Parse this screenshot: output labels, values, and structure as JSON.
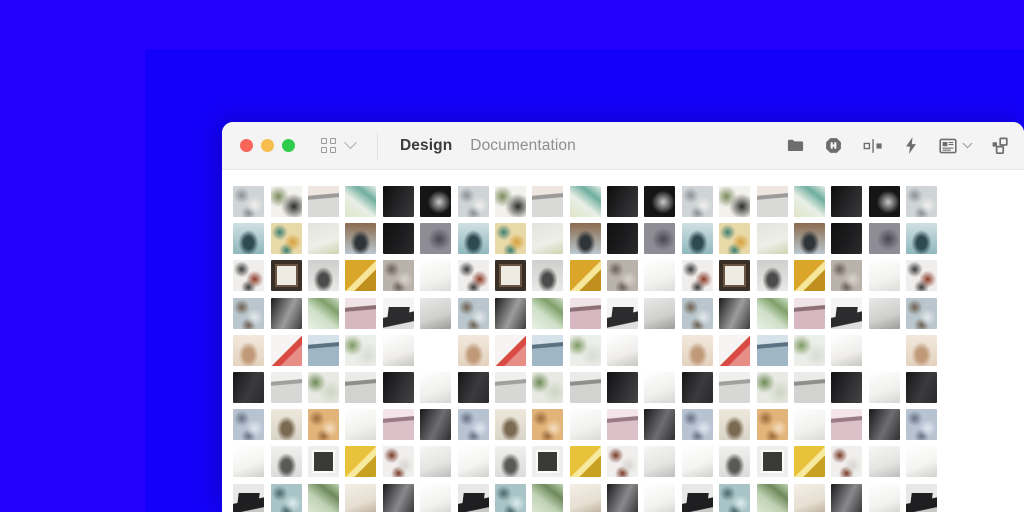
{
  "canvas": {
    "background_outer": "#2400ff",
    "background_inner": "#1400fa"
  },
  "window": {
    "traffic_lights": [
      {
        "name": "close",
        "color": "#f9655b"
      },
      {
        "name": "minimize",
        "color": "#f7bd4d"
      },
      {
        "name": "zoom",
        "color": "#2fcc4b"
      }
    ],
    "view_switcher": {
      "icon": "grid-icon",
      "chevron": "chevron-down-icon"
    },
    "tabs": [
      {
        "label": "Design",
        "active": true
      },
      {
        "label": "Documentation",
        "active": false
      }
    ],
    "toolbar_icons": [
      {
        "name": "folder-icon"
      },
      {
        "name": "components-octagon-icon"
      },
      {
        "name": "distribute-spacing-icon"
      },
      {
        "name": "lightning-bolt-icon"
      },
      {
        "name": "layout-preview-icon",
        "has_chevron": true
      },
      {
        "name": "duplicate-squares-icon"
      }
    ]
  },
  "gallery": {
    "columns": 19,
    "rows": 9,
    "tile_size": 31,
    "tile_pitch": 37.4,
    "palette_cycle": 6,
    "tiles": [
      {
        "id": "desk-flatlay",
        "c1": "#cfd4d6",
        "c2": "#8b9298",
        "c3": "#f0eeeb",
        "kind": "speckle"
      },
      {
        "id": "plant-person",
        "c1": "#f2f1ec",
        "c2": "#7b8a5c",
        "c3": "#2d2d2d",
        "kind": "leftleaf"
      },
      {
        "id": "grey-ceiling",
        "c1": "#d9d9d7",
        "c2": "#9b9b99",
        "c3": "#efe6e2",
        "kind": "bands"
      },
      {
        "id": "green-bottle",
        "c1": "#e9efe6",
        "c2": "#6fae9e",
        "c3": "#dfe4c8",
        "kind": "diag"
      },
      {
        "id": "dark-doorway",
        "c1": "#0c0c0d",
        "c2": "#272729",
        "c3": "#3a3a3c",
        "kind": "dark"
      },
      {
        "id": "dark-blur",
        "c1": "#151516",
        "c2": "#c9c9c9",
        "c3": "#2a2a2c",
        "kind": "darkblur"
      },
      {
        "id": "teal-portrait",
        "c1": "#8fb8bd",
        "c2": "#2f4a52",
        "c3": "#cfe0e2",
        "kind": "figure"
      },
      {
        "id": "colorful-desk",
        "c1": "#e8d9a8",
        "c2": "#3f7f6f",
        "c3": "#d6a03c",
        "kind": "speckle"
      },
      {
        "id": "paper-plant",
        "c1": "#efefea",
        "c2": "#cdd3b0",
        "c3": "#e3e3dd",
        "kind": "light"
      },
      {
        "id": "sunglasses-man",
        "c1": "#b9c7cf",
        "c2": "#2e3438",
        "c3": "#8b6b4e",
        "kind": "figure"
      },
      {
        "id": "black-square",
        "c1": "#0f0f10",
        "c2": "#1d1d1f",
        "c3": "#2b2b2d",
        "kind": "dark"
      },
      {
        "id": "street-blur",
        "c1": "#8e8d96",
        "c2": "#4a4650",
        "c3": "#c6c3cb",
        "kind": "darkblur"
      },
      {
        "id": "coffee-tools",
        "c1": "#efeeec",
        "c2": "#3b3b3b",
        "c3": "#8c3b2a",
        "kind": "speckle"
      },
      {
        "id": "framed-art",
        "c1": "#3a2f27",
        "c2": "#efeae2",
        "c3": "#6a5442",
        "kind": "frame"
      },
      {
        "id": "window-person",
        "c1": "#e9e9e7",
        "c2": "#4b4b4b",
        "c3": "#cfcfcd",
        "kind": "figure"
      },
      {
        "id": "yellow-notes",
        "c1": "#d9a62a",
        "c2": "#f6e79a",
        "c3": "#c08f1e",
        "kind": "notes"
      },
      {
        "id": "crowd-street",
        "c1": "#b9b2aa",
        "c2": "#6a625c",
        "c3": "#d8d2cb",
        "kind": "speckle"
      },
      {
        "id": "white-shelf",
        "c1": "#f2f2f0",
        "c2": "#dcdcd8",
        "c3": "#ffffff",
        "kind": "light"
      },
      {
        "id": "city-bench",
        "c1": "#b9c6cd",
        "c2": "#6f6152",
        "c3": "#e3e7ea",
        "kind": "speckle"
      },
      {
        "id": "dark-chair",
        "c1": "#1b1b1d",
        "c2": "#9c9c9c",
        "c3": "#3c3c3e",
        "kind": "dark"
      },
      {
        "id": "green-field",
        "c1": "#cfe0c8",
        "c2": "#7fa06a",
        "c3": "#eaf0e4",
        "kind": "diag"
      },
      {
        "id": "pink-building",
        "c1": "#d7b8c0",
        "c2": "#8e6f78",
        "c3": "#f0e2e5",
        "kind": "bands"
      },
      {
        "id": "white-laptop",
        "c1": "#f4f4f2",
        "c2": "#2c2c2e",
        "c3": "#dedede",
        "kind": "laptop"
      },
      {
        "id": "grey-wall",
        "c1": "#cfcfcd",
        "c2": "#9a9a98",
        "c3": "#e8e8e6",
        "kind": "light"
      },
      {
        "id": "nude-figure",
        "c1": "#e4d3c0",
        "c2": "#c09a78",
        "c3": "#f2e8dc",
        "kind": "figure"
      },
      {
        "id": "red-flowers",
        "c1": "#f6f4f2",
        "c2": "#d84a42",
        "c3": "#e88e86",
        "kind": "notes"
      },
      {
        "id": "mountain-lake",
        "c1": "#9fb6c4",
        "c2": "#5c7184",
        "c3": "#d6e2ea",
        "kind": "bands"
      },
      {
        "id": "plant-corner",
        "c1": "#eceee9",
        "c2": "#7e9a63",
        "c3": "#d8ddd2",
        "kind": "leftleaf"
      },
      {
        "id": "white-interior",
        "c1": "#efeeec",
        "c2": "#c8c6c2",
        "c3": "#ffffff",
        "kind": "light"
      },
      {
        "id": "beige-wall",
        "c1": "#ded7c8",
        "c2": "#b2a headers",
        "c3": "#f0ebe0",
        "kind": "light"
      },
      {
        "id": "dark-stairs",
        "c1": "#151517",
        "c2": "#3b3b3d",
        "c3": "#2a2a2c",
        "kind": "dark"
      },
      {
        "id": "grey-studio",
        "c1": "#d7d7d5",
        "c2": "#a0a09e",
        "c3": "#efefed",
        "kind": "bands"
      },
      {
        "id": "plant-shelf",
        "c1": "#e7e9e2",
        "c2": "#6f8a55",
        "c3": "#cfd6c4",
        "kind": "leftleaf"
      },
      {
        "id": "grey-blinds",
        "c1": "#d2d2d0",
        "c2": "#8e8e8c",
        "c3": "#eaeae8",
        "kind": "bands"
      },
      {
        "id": "dark-figure",
        "c1": "#111113",
        "c2": "#2f2f31",
        "c3": "#454547",
        "kind": "dark"
      },
      {
        "id": "white-room",
        "c1": "#f0f0ee",
        "c2": "#d4d4d0",
        "c3": "#ffffff",
        "kind": "light"
      },
      {
        "id": "blue-interior",
        "c1": "#b8c3d2",
        "c2": "#6a7488",
        "c3": "#e0e6ee",
        "kind": "speckle"
      },
      {
        "id": "buddha-statue",
        "c1": "#d9d4c8",
        "c2": "#7a6a52",
        "c3": "#efe9dc",
        "kind": "figure"
      },
      {
        "id": "orange-desk",
        "c1": "#e2b47a",
        "c2": "#9a6a3a",
        "c3": "#f3ddc0",
        "kind": "speckle"
      },
      {
        "id": "paper-stack",
        "c1": "#f1f1ef",
        "c2": "#d9d9d5",
        "c3": "#ffffff",
        "kind": "light"
      },
      {
        "id": "pink-shelves",
        "c1": "#dcc2c8",
        "c2": "#9a7a84",
        "c3": "#f2e4e8",
        "kind": "bands"
      },
      {
        "id": "black-glass",
        "c1": "#18181a",
        "c2": "#6e6e70",
        "c3": "#2e2e30",
        "kind": "dark"
      },
      {
        "id": "white-hanging",
        "c1": "#f4f4f2",
        "c2": "#cfcfcb",
        "c3": "#ffffff",
        "kind": "light"
      },
      {
        "id": "grey-portrait",
        "c1": "#dcdcda",
        "c2": "#5a5a58",
        "c3": "#f0f0ee",
        "kind": "figure"
      },
      {
        "id": "frame-white",
        "c1": "#eeeeec",
        "c2": "#3a3a38",
        "c3": "#fafaf8",
        "kind": "frame"
      },
      {
        "id": "yellow-note",
        "c1": "#e8c23a",
        "c2": "#f7ea9e",
        "c3": "#c9a122",
        "kind": "notes"
      },
      {
        "id": "coffee-top",
        "c1": "#f0efed",
        "c2": "#7a3b2a",
        "c3": "#d8d6d2",
        "kind": "speckle"
      },
      {
        "id": "soft-grey",
        "c1": "#e4e4e2",
        "c2": "#bcbcba",
        "c3": "#f6f6f4",
        "kind": "light"
      },
      {
        "id": "dark-laptop",
        "c1": "#e8e8e6",
        "c2": "#1f1f21",
        "c3": "#c8c8c6",
        "kind": "laptop"
      },
      {
        "id": "teal-cup",
        "c1": "#a9c4c6",
        "c2": "#4a6a6c",
        "c3": "#dcebec",
        "kind": "speckle"
      },
      {
        "id": "green-hills",
        "c1": "#bfd2b4",
        "c2": "#6f8a5c",
        "c3": "#e2ead8",
        "kind": "diag"
      },
      {
        "id": "beige-minimal",
        "c1": "#e6dfd2",
        "c2": "#b8ab96",
        "c3": "#f4efe6",
        "kind": "light"
      },
      {
        "id": "dark-desk",
        "c1": "#1a1a1c",
        "c2": "#8a8a8c",
        "c3": "#333335",
        "kind": "dark"
      },
      {
        "id": "white-table",
        "c1": "#f2f2f0",
        "c2": "#d2d2ce",
        "c3": "#ffffff",
        "kind": "light"
      },
      {
        "id": "book-stack",
        "c1": "#ddd8cc",
        "c2": "#8a7f6c",
        "c3": "#f0ece2",
        "kind": "bands"
      },
      {
        "id": "grey-chair",
        "c1": "#cdcdcb",
        "c2": "#7e7e7c",
        "c3": "#e8e8e6",
        "kind": "figure"
      },
      {
        "id": "plant-window",
        "c1": "#e8ece4",
        "c2": "#6f9a5c",
        "c3": "#d2dcc8",
        "kind": "leftleaf"
      },
      {
        "id": "dark-screen",
        "c1": "#141416",
        "c2": "#4a4a4c",
        "c3": "#28282a",
        "kind": "dark"
      },
      {
        "id": "warm-light",
        "c1": "#e8d6b8",
        "c2": "#b89a70",
        "c3": "#f6ecd8",
        "kind": "light"
      },
      {
        "id": "cool-grey",
        "c1": "#dcdee2",
        "c2": "#9a9ca0",
        "c3": "#f0f2f6",
        "kind": "light"
      }
    ]
  }
}
